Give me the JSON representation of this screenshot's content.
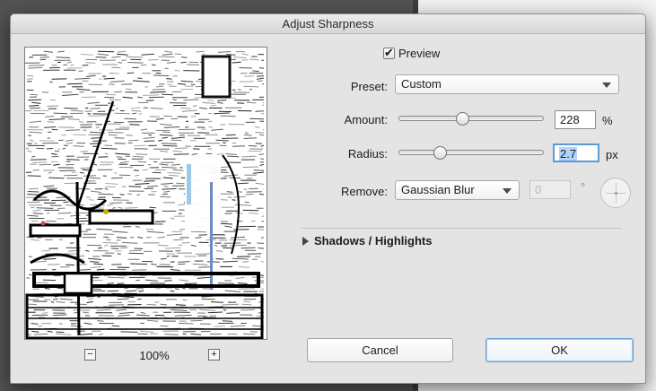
{
  "window": {
    "title": "Adjust Sharpness"
  },
  "preview": {
    "checkbox_label": "Preview",
    "checked": true,
    "zoom_minus": "−",
    "zoom_plus": "+",
    "zoom_level": "100%"
  },
  "preset": {
    "label": "Preset:",
    "value": "Custom"
  },
  "amount": {
    "label": "Amount:",
    "value": "228",
    "unit": "%",
    "slider_fraction": 0.46
  },
  "radius": {
    "label": "Radius:",
    "value": "2.7",
    "unit": "px",
    "slider_fraction": 0.28
  },
  "remove": {
    "label": "Remove:",
    "value": "Gaussian Blur",
    "angle_value": "0",
    "angle_unit": "°"
  },
  "section": {
    "shadows_highlights": "Shadows / Highlights"
  },
  "buttons": {
    "cancel": "Cancel",
    "ok": "OK"
  },
  "icons": {
    "checkbox": "checkmark-icon",
    "dropdown": "chevron-down-icon",
    "disclosure": "triangle-right-icon",
    "angle": "angle-dial-icon",
    "zoom_out": "minus-icon",
    "zoom_in": "plus-icon"
  },
  "colors": {
    "dialog_bg": "#e4e4e4",
    "focus_ring": "#5b9bd5",
    "selection": "#b3d4fc",
    "default_button_border": "#6aa0d8"
  }
}
